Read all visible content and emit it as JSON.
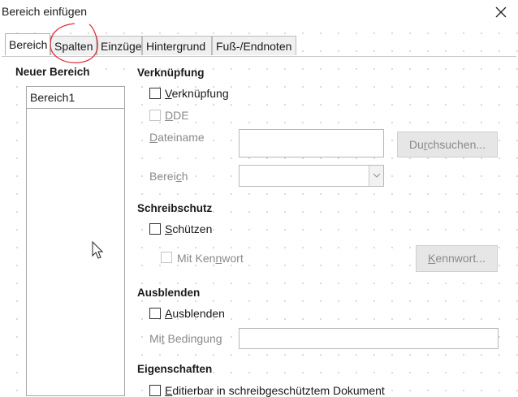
{
  "window": {
    "title": "Bereich einfügen",
    "close_icon": "close-icon"
  },
  "tabs": [
    {
      "label": "Bereich"
    },
    {
      "label": "Spalten"
    },
    {
      "label": "Einzüge"
    },
    {
      "label": "Hintergrund"
    },
    {
      "label": "Fuß-/Endnoten"
    }
  ],
  "new_section": {
    "heading": "Neuer Bereich",
    "name_value": "Bereich1"
  },
  "link": {
    "heading": "Verknüpfung",
    "link_checkbox": {
      "pre": "",
      "accel": "V",
      "post": "erknüpfung"
    },
    "dde_checkbox": {
      "pre": "",
      "accel": "D",
      "post": "DE"
    },
    "filename_label": {
      "pre": "",
      "accel": "D",
      "post": "ateiname"
    },
    "filename_value": "",
    "browse_button": {
      "pre": "Du",
      "accel": "r",
      "post": "chsuchen..."
    },
    "section_label": {
      "pre": "Berei",
      "accel": "c",
      "post": "h"
    },
    "section_value": ""
  },
  "write_protection": {
    "heading": "Schreibschutz",
    "protect_checkbox": {
      "pre": "",
      "accel": "S",
      "post": "chützen"
    },
    "password_checkbox": {
      "pre": "Mit Ken",
      "accel": "n",
      "post": "wort"
    },
    "password_button": {
      "pre": "",
      "accel": "K",
      "post": "ennwort..."
    }
  },
  "hide": {
    "heading": "Ausblenden",
    "hide_checkbox": {
      "pre": "",
      "accel": "A",
      "post": "usblenden"
    },
    "condition_label": {
      "pre": "Mi",
      "accel": "t",
      "post": " Bedingung"
    },
    "condition_value": ""
  },
  "properties": {
    "heading": "Eigenschaften",
    "editable_checkbox": {
      "pre": "",
      "accel": "E",
      "post": "ditierbar in schreibgeschütztem Dokument"
    }
  },
  "colors": {
    "annotation": "#e0303a",
    "disabled_text": "#8a8a8a"
  }
}
